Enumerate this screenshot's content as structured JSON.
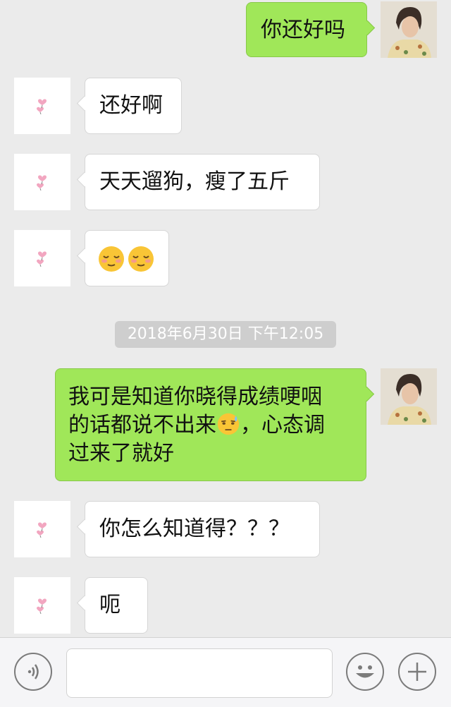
{
  "messages": [
    {
      "text": "你还好吗"
    },
    {
      "text": "还好啊"
    },
    {
      "text": "天天遛狗，瘦了五斤"
    },
    {
      "emoji": "relieved-face-emoji"
    },
    {
      "text_line1": "我可是知道你晓得成绩哽咽",
      "text_line2_a": "的话都说不出来",
      "text_line2_b": "，心态调",
      "text_line3": "过来了就好",
      "emoji": "face-with-sweat-emoji"
    },
    {
      "text": "你怎么知道得？？？"
    },
    {
      "text": "呃"
    }
  ],
  "timestamp": "2018年6月30日  下午12:05",
  "input_bar": {
    "placeholder": "",
    "icons": [
      "voice-icon",
      "emoji-icon",
      "add-icon"
    ]
  },
  "colors": {
    "background": "#ebebeb",
    "outgoing_bubble": "#a0e759",
    "incoming_bubble": "#ffffff",
    "timestamp_bg": "#cecece"
  }
}
